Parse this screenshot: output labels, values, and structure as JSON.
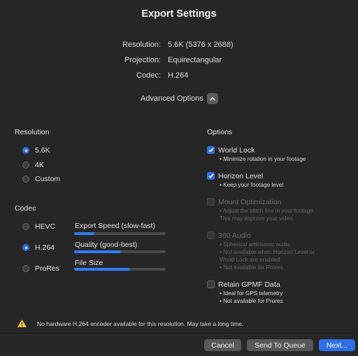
{
  "title": "Export Settings",
  "info": [
    {
      "label": "Resolution:",
      "value": "5.6K (5376 x 2688)"
    },
    {
      "label": "Projection:",
      "value": "Equirectangular"
    },
    {
      "label": "Codec:",
      "value": "H.264"
    }
  ],
  "advanced": {
    "label": "Advanced Options",
    "icon": "chevron-up-icon",
    "expanded": true
  },
  "resolution": {
    "heading": "Resolution",
    "options": [
      "5.6K",
      "4K",
      "Custom"
    ],
    "selected": "5.6K"
  },
  "codec": {
    "heading": "Codec",
    "options": [
      "HEVC",
      "H.264",
      "ProRes"
    ],
    "selected": "H.264"
  },
  "sliders": [
    {
      "label": "Export Speed (slow-fast)",
      "value": 0.22
    },
    {
      "label": "Quality (good-best)",
      "value": 0.51
    },
    {
      "label": "File Size",
      "value": 0.61
    }
  ],
  "options": {
    "heading": "Options",
    "items": [
      {
        "label": "World Lock",
        "checked": true,
        "enabled": true,
        "notes": [
          "• Minimize rotation in your footage"
        ]
      },
      {
        "label": "Horizon Level",
        "checked": true,
        "enabled": true,
        "notes": [
          "• Keep your footage level"
        ]
      },
      {
        "label": "Mount Optimization",
        "checked": false,
        "enabled": false,
        "notes": [
          "• Adjust the stitch line in your footage.",
          "This may improve your video."
        ]
      },
      {
        "label": "360 Audio",
        "checked": false,
        "enabled": false,
        "notes": [
          "• Spherical ambisonic audio",
          "• Not available when Horizon Level or",
          "World Lock are enabled",
          "• Not available for Prores"
        ]
      },
      {
        "label": "Retain GPMF Data",
        "checked": false,
        "enabled": true,
        "notes": [
          "• Ideal for GPS telemetry",
          "• Not available for Prores"
        ]
      }
    ]
  },
  "warning": {
    "icon": "warning-triangle-icon",
    "text": "No hardware H.264 encoder available for this resolution. May take a long time."
  },
  "buttons": {
    "cancel": "Cancel",
    "queue": "Send To Queue",
    "next": "Next..."
  },
  "colors": {
    "accent": "#2e6fe3",
    "background": "#262626",
    "warning": "#f2c94c"
  }
}
